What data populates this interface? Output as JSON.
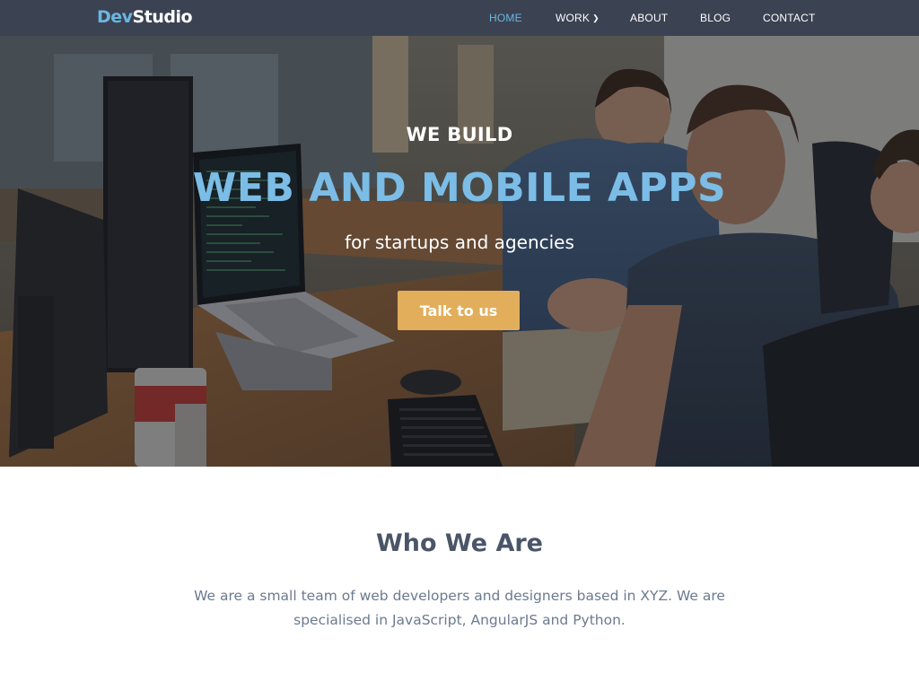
{
  "brand": {
    "part1": "Dev",
    "part2": "Studio"
  },
  "nav": {
    "items": [
      {
        "label": "HOME",
        "active": true
      },
      {
        "label": "WORK",
        "active": false,
        "has_dropdown": true
      },
      {
        "label": "ABOUT",
        "active": false
      },
      {
        "label": "BLOG",
        "active": false
      },
      {
        "label": "CONTACT",
        "active": false
      }
    ]
  },
  "hero": {
    "eyebrow": "WE BUILD",
    "title": "WEB AND MOBILE APPS",
    "subtitle": "for startups and agencies",
    "cta_label": "Talk to us",
    "image": "office-team-photo"
  },
  "about": {
    "title": "Who We Are",
    "text": "We are a small team of web developers and designers based in XYZ. We are specialised in JavaScript, AngularJS and Python."
  },
  "colors": {
    "nav_bg": "#3b4252",
    "accent": "#6cb6e0",
    "cta": "#e2ae5c",
    "heading": "#4a5568",
    "body_text": "#6b7a90"
  }
}
